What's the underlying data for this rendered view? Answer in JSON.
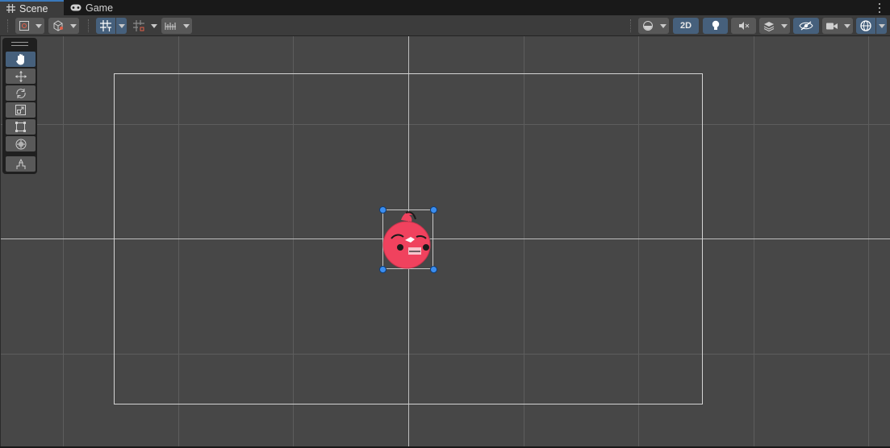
{
  "tabs": [
    {
      "label": "Scene",
      "icon": "grid-hash-icon",
      "active": true
    },
    {
      "label": "Game",
      "icon": "gamepad-icon",
      "active": false
    }
  ],
  "toolbar": {
    "mode_2d_label": "2D",
    "accent_color": "#46607c"
  },
  "tools": [
    {
      "name": "hand-tool",
      "icon": "hand-icon",
      "active": true
    },
    {
      "name": "move-tool",
      "icon": "move-arrows-icon",
      "active": false
    },
    {
      "name": "rotate-tool",
      "icon": "rotate-icon",
      "active": false
    },
    {
      "name": "scale-tool",
      "icon": "scale-icon",
      "active": false
    },
    {
      "name": "rect-tool",
      "icon": "rect-transform-icon",
      "active": false
    },
    {
      "name": "transform-tool",
      "icon": "transform-icon",
      "active": false
    },
    {
      "name": "custom-tool",
      "icon": "custom-tool-icon",
      "active": false
    }
  ],
  "colors": {
    "scene_background": "#474747",
    "handle_blue": "#3b8ef0",
    "sprite_red": "#f0425e"
  }
}
